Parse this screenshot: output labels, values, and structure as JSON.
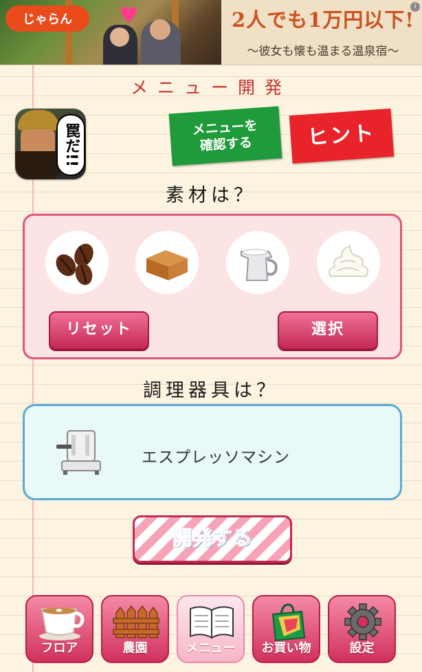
{
  "ad": {
    "brand": "じゃらん",
    "headline": "2人でも1万円以下!",
    "subline": "～彼女も懐も温まる温泉宿～",
    "info": "i"
  },
  "header": {
    "title": "メニュー開発",
    "avatar_speech": "罠だ!!",
    "confirm_button_line1": "メニューを",
    "confirm_button_line2": "確認する",
    "hint_button": "ヒント"
  },
  "ingredients": {
    "question": "素材は？",
    "items": [
      "coffee-beans",
      "caramel",
      "milk-pitcher",
      "whipped-cream"
    ],
    "reset_label": "リセット",
    "select_label": "選択"
  },
  "tool": {
    "question": "調理器具は？",
    "name": "エスプレッソマシン"
  },
  "develop_label": "開発する",
  "nav": {
    "items": [
      {
        "label": "フロア",
        "icon": "coffee-cup-icon"
      },
      {
        "label": "農園",
        "icon": "fence-icon"
      },
      {
        "label": "メニュー",
        "icon": "open-book-icon",
        "active": true
      },
      {
        "label": "お買い物",
        "icon": "shopping-bag-icon"
      },
      {
        "label": "設定",
        "icon": "gear-icon"
      }
    ]
  },
  "colors": {
    "title": "#c8302a",
    "confirm": "#1f9b3b",
    "hint": "#e8232a",
    "pink": "#e0557a",
    "blue": "#5aa9d6"
  }
}
